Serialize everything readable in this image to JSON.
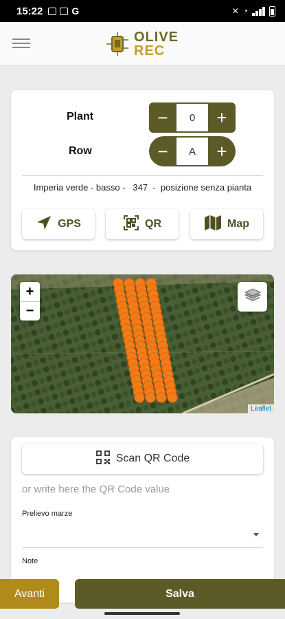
{
  "status_bar": {
    "time": "15:22",
    "carrier_glyph": "G"
  },
  "header": {
    "logo_line1": "OLIVE",
    "logo_line2": "REC",
    "icons": [
      "menu-icon",
      "olive-rec-logo"
    ]
  },
  "control": {
    "plant": {
      "label": "Plant",
      "value": "0",
      "minus": "−",
      "plus": "+"
    },
    "row": {
      "label": "Row",
      "value": "A",
      "minus": "−",
      "plus": "+"
    },
    "location": {
      "field": "Imperia verde - basso -",
      "number": "347",
      "status": "posizione senza pianta"
    },
    "actions": [
      {
        "label": "GPS",
        "icon": "navigation-arrow-icon"
      },
      {
        "label": "QR",
        "icon": "qr-scan-icon"
      },
      {
        "label": "Map",
        "icon": "map-icon"
      }
    ]
  },
  "map": {
    "zoom_in": "+",
    "zoom_out": "−",
    "attribution": "Leaflet",
    "icons": [
      "layers-icon"
    ],
    "colors": {
      "marker": "#f07d1a",
      "marker_stroke": "#e0650a"
    }
  },
  "form": {
    "scan_label": "Scan QR Code",
    "qr_placeholder": "or write here the QR Code value",
    "prelievo_label": "Prelievo marze",
    "prelievo_value": "",
    "note_label": "Note"
  },
  "footer": {
    "avanti_label": "Avanti",
    "salva_label": "Salva"
  },
  "colors": {
    "olive_dark": "#5c5a27",
    "gold": "#b08a1a",
    "logo_olive": "#6b6a2a",
    "logo_gold": "#c79d22"
  }
}
